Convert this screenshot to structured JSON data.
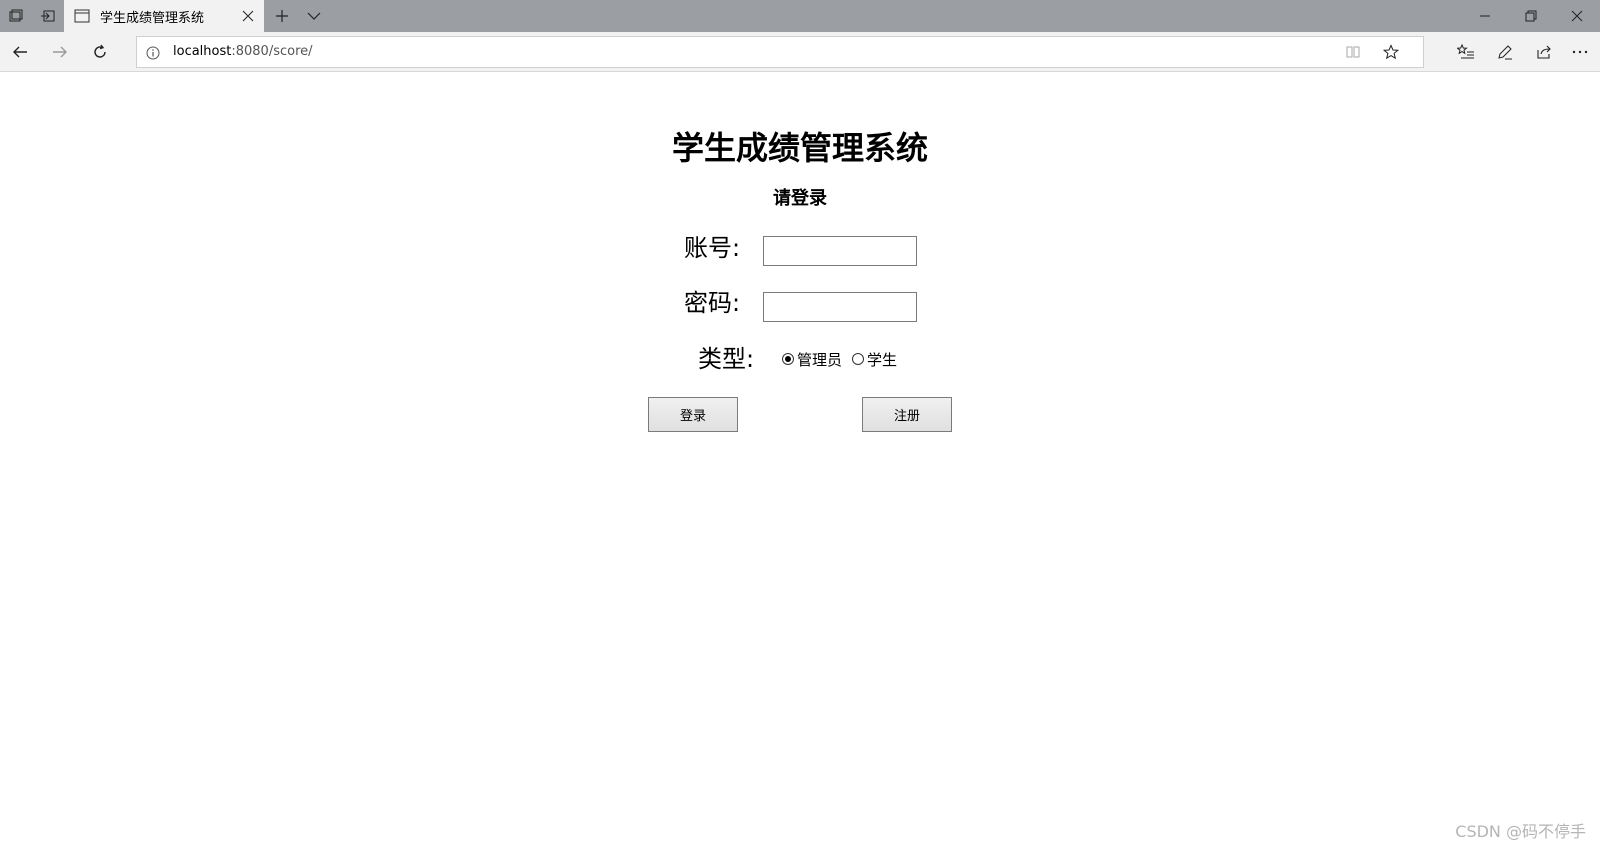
{
  "browser": {
    "tab_title": "学生成绩管理系统",
    "url_host": "localhost",
    "url_rest": ":8080/score/"
  },
  "page": {
    "title": "学生成绩管理系统",
    "subtitle": "请登录",
    "account_label": "账号:",
    "account_value": "",
    "password_label": "密码:",
    "password_value": "",
    "type_label": "类型:",
    "type_options": [
      {
        "label": "管理员",
        "selected": true
      },
      {
        "label": "学生",
        "selected": false
      }
    ],
    "login_button": "登录",
    "register_button": "注册"
  },
  "watermark": "CSDN @码不停手",
  "colors": {
    "tabbar_bg": "#9b9ea3",
    "chrome_bg": "#f2f2f2",
    "button_bg": "#e1e1e1"
  }
}
